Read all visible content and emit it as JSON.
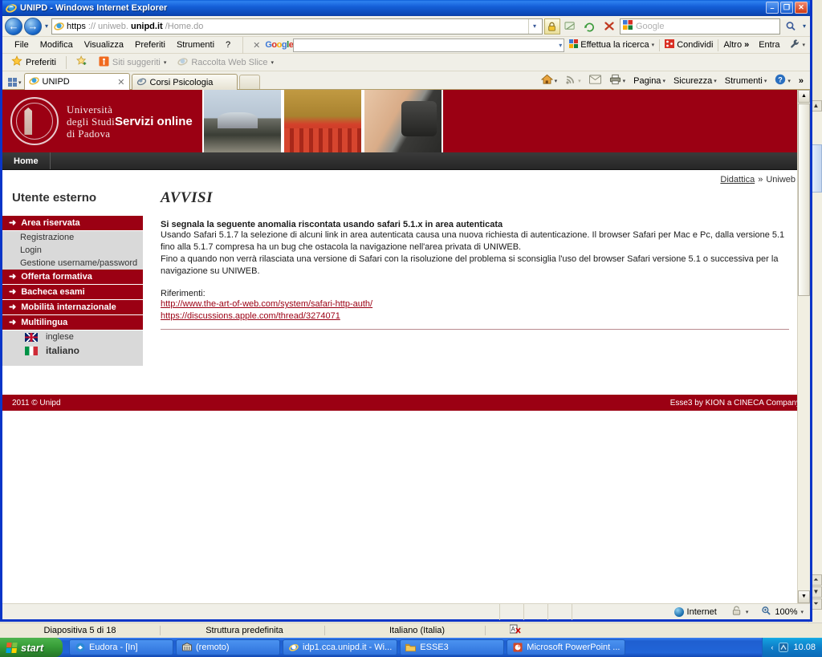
{
  "window": {
    "title": "UNIPD - Windows Internet Explorer",
    "icon": "ie-icon",
    "minimize": "–",
    "maximize": "❐",
    "close": "✕"
  },
  "browser": {
    "back_icon": "back-arrow-icon",
    "forward_icon": "forward-arrow-icon",
    "history_caret": "▾",
    "address": {
      "favicon": "ie-page-icon",
      "scheme": "https",
      "sep": "://",
      "host_sub": "uniweb.",
      "host_main": "unipd.it",
      "path": "/Home.do",
      "dropdown": "▾"
    },
    "lock_icon": "lock-icon",
    "compat_icon": "compatibility-view-icon",
    "refresh_icon": "↻",
    "stop_icon": "✕",
    "search": {
      "provider": "Google",
      "placeholder": "Google",
      "go_icon": "magnifier-icon",
      "dropdown": "▾"
    },
    "menu": [
      "File",
      "Modifica",
      "Visualizza",
      "Preferiti",
      "Strumenti",
      "?"
    ],
    "google_toolbar": {
      "close": "✕",
      "brand": "Google",
      "input_value": "",
      "input_caret": "▾",
      "search_button": "Effettua la ricerca",
      "share_button": "Condividi",
      "more_button": "Altro",
      "more_icon": "»",
      "signin_button": "Entra",
      "settings_icon": "wrench-icon",
      "caret": "▾"
    },
    "favorites_bar": {
      "favorites": "Preferiti",
      "star_icon": "star-icon",
      "add_icon": "add-favorite-icon",
      "suggested_sites": "Siti suggeriti",
      "web_slice": "Raccolta Web Slice",
      "caret": "▾"
    },
    "tabs": {
      "quicktab_icon": "quick-tabs-icon",
      "quicktab_caret": "▾",
      "items": [
        {
          "label": "UNIPD",
          "icon": "ie-icon",
          "active": true,
          "close": "✕"
        },
        {
          "label": "Corsi Psicologia",
          "icon": "page-icon",
          "active": false
        }
      ]
    },
    "command_bar": {
      "home_icon": "home-icon",
      "feeds_icon": "rss-icon",
      "mail_icon": "mail-icon",
      "print_icon": "printer-icon",
      "page": "Pagina",
      "safety": "Sicurezza",
      "tools": "Strumenti",
      "help_icon": "help-icon",
      "overflow": "»",
      "caret": "▾"
    },
    "status_bar": {
      "zone": "Internet",
      "zone_icon": "globe-icon",
      "protected_icon": "protected-mode-icon",
      "zoom": "100%",
      "zoom_icon": "zoom-icon",
      "caret": "▾"
    },
    "page_scrollbar": {
      "up": "▲",
      "down": "▼"
    }
  },
  "site": {
    "banner": {
      "crest_alt": "unipd-crest",
      "university_line1": "Università",
      "university_line2": "degli Studi",
      "university_line3": "di Padova",
      "tagline": "Servizi online",
      "photos": [
        "observatory-photo",
        "aula-magna-photo",
        "microscope-photo"
      ]
    },
    "nav": {
      "home": "Home"
    },
    "breadcrumb": {
      "link": "Didattica",
      "separator": "»",
      "current": "Uniweb"
    },
    "sidebar": {
      "user_title": "Utente esterno",
      "groups": [
        {
          "header": "Area riservata",
          "arrow": "➜",
          "items": [
            "Registrazione",
            "Login",
            "Gestione username/password"
          ]
        },
        {
          "header": "Offerta formativa",
          "arrow": "➜",
          "items": []
        },
        {
          "header": "Bacheca esami",
          "arrow": "➜",
          "items": []
        },
        {
          "header": "Mobilità internazionale",
          "arrow": "➜",
          "items": []
        },
        {
          "header": "Multilingua",
          "arrow": "➜",
          "languages": [
            {
              "label": "inglese",
              "flag": "uk-flag-icon",
              "selected": false
            },
            {
              "label": "italiano",
              "flag": "italy-flag-icon",
              "selected": true
            }
          ]
        }
      ]
    },
    "main": {
      "heading": "AVVISI",
      "notice_title": "Si segnala la seguente anomalia riscontata usando safari 5.1.x in area autenticata",
      "paragraphs": [
        "Usando Safari 5.1.7 la selezione di alcuni link in area autenticata causa una nuova richiesta di autenticazione. Il browser Safari per Mac e Pc, dalla versione 5.1",
        "fino alla 5.1.7 compresa ha un bug che ostacola la navigazione nell'area privata di UNIWEB.",
        "Fino a quando non verrà rilasciata una versione di Safari con la risoluzione del problema si sconsiglia l'uso del browser Safari versione 5.1 o successiva per la",
        "navigazione su UNIWEB."
      ],
      "references_label": "Riferimenti:",
      "references": [
        "http://www.the-art-of-web.com/system/safari-http-auth/",
        "https://discussions.apple.com/thread/3274071"
      ]
    },
    "footer": {
      "copyright": "2011 © Unipd",
      "credits": "Esse3 by KION a CINECA Company"
    }
  },
  "powerpoint": {
    "status": {
      "slide": "Diapositiva 5 di 18",
      "design": "Struttura predefinita",
      "language": "Italiano (Italia)",
      "spellcheck_icon": "spellcheck-icon"
    },
    "scroll": {
      "up": "▲",
      "prev": "⏶",
      "next": "⏷",
      "down": "▼"
    }
  },
  "taskbar": {
    "start": "start",
    "start_icon": "windows-flag-icon",
    "tasks": [
      {
        "label": "Eudora - [In]",
        "icon": "eudora-icon"
      },
      {
        "label": "(remoto)",
        "icon": "remote-icon"
      },
      {
        "label": "idp1.cca.unipd.it - Wi...",
        "icon": "ie-icon"
      },
      {
        "label": "ESSE3",
        "icon": "folder-icon"
      },
      {
        "label": "Microsoft PowerPoint ...",
        "icon": "powerpoint-icon"
      }
    ],
    "tray": {
      "chevron": "‹",
      "icons": [
        "network-icon"
      ],
      "clock": "10.08"
    }
  },
  "colors": {
    "brand_red": "#9b0013",
    "link_red": "#9b0013",
    "sidebar_bg": "#d9d9d9",
    "nav_dark": "#2e2e2e",
    "title_blue": "#0a46b4"
  }
}
